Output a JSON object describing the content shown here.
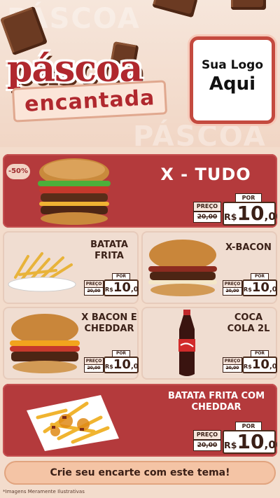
{
  "header": {
    "title_top": "páscoa",
    "title_bottom": "encantada",
    "logo_line1": "Sua Logo",
    "logo_line2": "Aqui"
  },
  "products": [
    {
      "name": "X - TUDO",
      "discount": "-50%",
      "old_label": "PREÇO",
      "old_price": "20,00",
      "por_label": "POR",
      "currency": "R$",
      "price_int": "10",
      "price_dec": ",00"
    },
    {
      "name": "BATATA FRITA",
      "old_label": "PREÇO",
      "old_price": "20,00",
      "por_label": "POR",
      "currency": "R$",
      "price_int": "10",
      "price_dec": ",00"
    },
    {
      "name": "X-BACON",
      "old_label": "PREÇO",
      "old_price": "20,00",
      "por_label": "POR",
      "currency": "R$",
      "price_int": "10",
      "price_dec": ",00"
    },
    {
      "name": "X BACON E CHEDDAR",
      "old_label": "PREÇO",
      "old_price": "20,00",
      "por_label": "POR",
      "currency": "R$",
      "price_int": "10",
      "price_dec": ",00"
    },
    {
      "name": "COCA COLA 2L",
      "old_label": "PREÇO",
      "old_price": "20,00",
      "por_label": "POR",
      "currency": "R$",
      "price_int": "10",
      "price_dec": ",00"
    },
    {
      "name": "BATATA FRITA COM CHEDDAR",
      "old_label": "PREÇO",
      "old_price": "20,00",
      "por_label": "POR",
      "currency": "R$",
      "price_int": "10",
      "price_dec": ",00"
    }
  ],
  "cta": "Crie seu encarte com este tema!",
  "footnote": "*Imagens Meramente Ilustrativas",
  "colors": {
    "red": "#b43a3c",
    "beige": "#f0ddd1",
    "chocolate": "#6b3a22",
    "cta": "#f4c4a5"
  }
}
